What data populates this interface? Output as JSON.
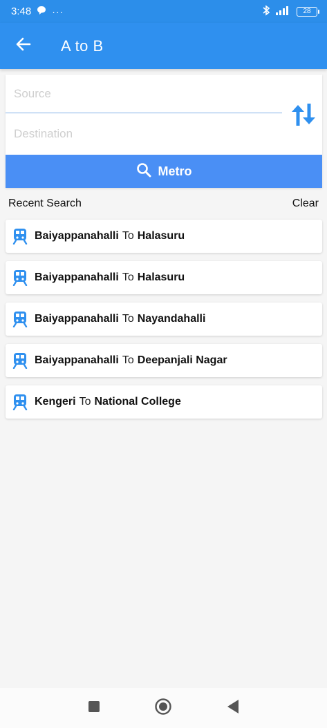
{
  "status_bar": {
    "time": "3:48",
    "dots": "···",
    "battery": "28"
  },
  "app_bar": {
    "title": "A to B",
    "back_icon": "arrow-left-icon"
  },
  "search": {
    "source_placeholder": "Source",
    "destination_placeholder": "Destination",
    "swap_icon": "swap-vertical-icon",
    "metro_button_label": "Metro",
    "metro_button_icon": "search-icon"
  },
  "recent": {
    "title": "Recent Search",
    "clear_label": "Clear",
    "connector": "To",
    "items": [
      {
        "from": "Baiyappanahalli",
        "to": "Halasuru"
      },
      {
        "from": "Baiyappanahalli",
        "to": "Halasuru"
      },
      {
        "from": "Baiyappanahalli",
        "to": "Nayandahalli"
      },
      {
        "from": "Baiyappanahalli",
        "to": "Deepanjali Nagar"
      },
      {
        "from": "Kengeri",
        "to": "National College"
      }
    ]
  },
  "colors": {
    "status_bar": "#2c8eea",
    "app_bar": "#2f90ef",
    "metro_button": "#4a8ff5",
    "icon_blue": "#2f90ef"
  }
}
